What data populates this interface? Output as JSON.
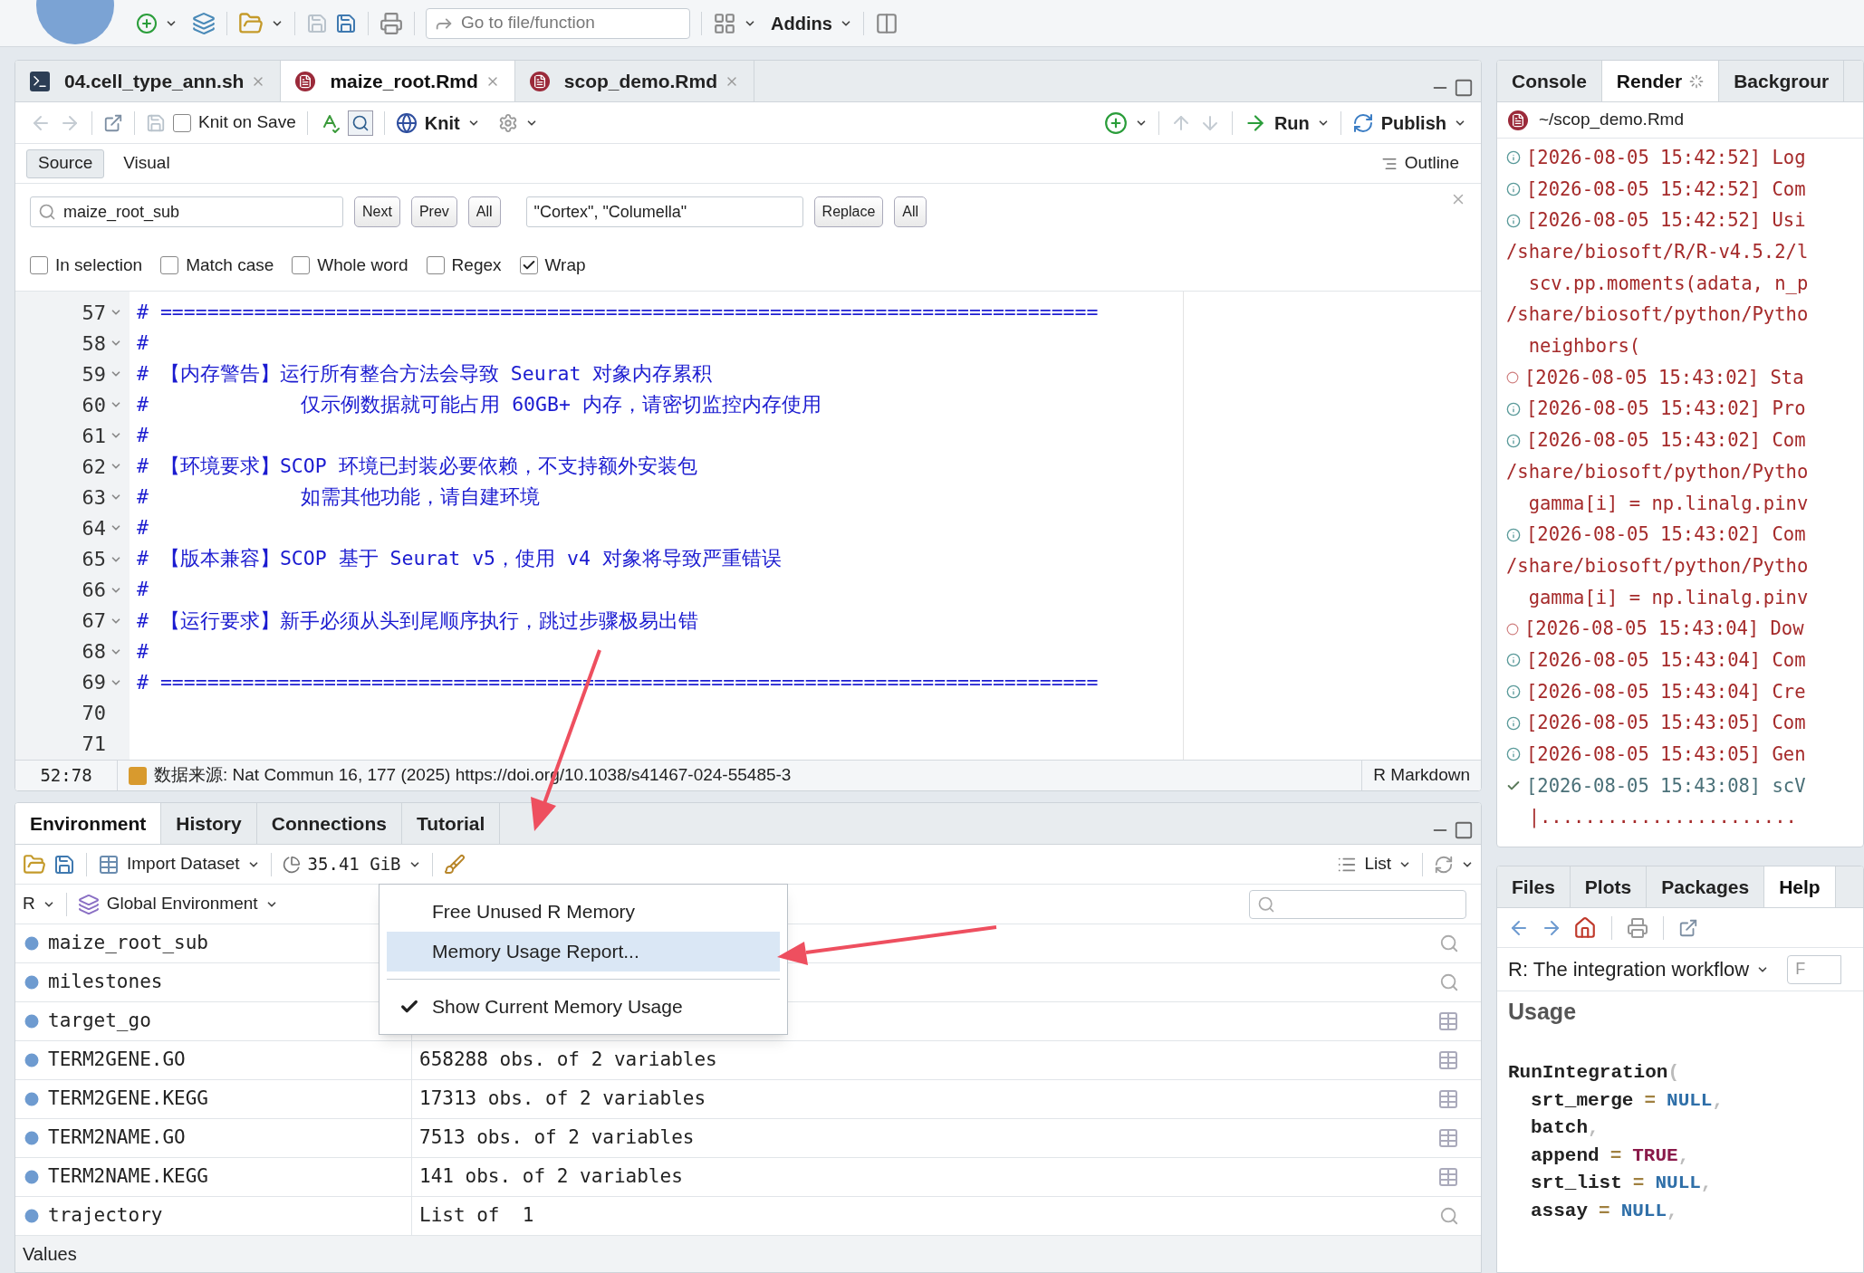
{
  "toolbar": {
    "goto_placeholder": "Go to file/function",
    "addins": "Addins"
  },
  "editor": {
    "tabs": [
      {
        "label": "04.cell_type_ann.sh",
        "kind": "shell",
        "selected": false
      },
      {
        "label": "maize_root.Rmd",
        "kind": "rmd",
        "selected": true
      },
      {
        "label": "scop_demo.Rmd",
        "kind": "rmd",
        "selected": false
      }
    ],
    "knit_on_save": {
      "label": "Knit on Save",
      "checked": false
    },
    "knit": "Knit",
    "run": "Run",
    "publish": "Publish",
    "modes": [
      {
        "label": "Source",
        "selected": true
      },
      {
        "label": "Visual",
        "selected": false
      }
    ],
    "outline": "Outline",
    "find": {
      "value": "maize_root_sub",
      "buttons": [
        "Next",
        "Prev",
        "All"
      ],
      "replace_value": "\"Cortex\", \"Columella\"",
      "replace_buttons": [
        "Replace",
        "All"
      ]
    },
    "options": [
      {
        "label": "In selection",
        "checked": false
      },
      {
        "label": "Match case",
        "checked": false
      },
      {
        "label": "Whole word",
        "checked": false
      },
      {
        "label": "Regex",
        "checked": false
      },
      {
        "label": "Wrap",
        "checked": true
      }
    ],
    "lines": [
      {
        "number": "57",
        "fold": true,
        "text": "# ================================================================================"
      },
      {
        "number": "58",
        "fold": true,
        "text": "#"
      },
      {
        "number": "59",
        "fold": true,
        "text": "# 【内存警告】运行所有整合方法会导致 Seurat 对象内存累积"
      },
      {
        "number": "60",
        "fold": true,
        "text": "#             仅示例数据就可能占用 60GB+ 内存，请密切监控内存使用"
      },
      {
        "number": "61",
        "fold": true,
        "text": "#"
      },
      {
        "number": "62",
        "fold": true,
        "text": "# 【环境要求】SCOP 环境已封装必要依赖，不支持额外安装包"
      },
      {
        "number": "63",
        "fold": true,
        "text": "#             如需其他功能，请自建环境"
      },
      {
        "number": "64",
        "fold": true,
        "text": "#"
      },
      {
        "number": "65",
        "fold": true,
        "text": "# 【版本兼容】SCOP 基于 Seurat v5，使用 v4 对象将导致严重错误"
      },
      {
        "number": "66",
        "fold": true,
        "text": "#"
      },
      {
        "number": "67",
        "fold": true,
        "text": "# 【运行要求】新手必须从头到尾顺序执行，跳过步骤极易出错"
      },
      {
        "number": "68",
        "fold": true,
        "text": "#"
      },
      {
        "number": "69",
        "fold": true,
        "text": "# ================================================================================"
      },
      {
        "number": "70",
        "fold": false
      },
      {
        "number": "71",
        "fold": false
      }
    ],
    "status": {
      "position": "52:78",
      "chunk": "数据来源: Nat Commun 16, 177 (2025) https://doi.org/10.1038/s41467-024-55485-3",
      "language": "R Markdown"
    }
  },
  "environment": {
    "tabs": [
      {
        "label": "Environment",
        "selected": true
      },
      {
        "label": "History",
        "selected": false
      },
      {
        "label": "Connections",
        "selected": false
      },
      {
        "label": "Tutorial",
        "selected": false
      }
    ],
    "import": "Import Dataset",
    "memory": "35.41 GiB",
    "view": "List",
    "language": "R",
    "scope": "Global Environment",
    "rows": [
      {
        "name": "maize_root_sub",
        "kind": "view"
      },
      {
        "name": "milestones",
        "kind": "view"
      },
      {
        "name": "target_go",
        "kind": "table"
      },
      {
        "name": "TERM2GENE.GO",
        "value": "658288 obs. of 2 variables",
        "kind": "table"
      },
      {
        "name": "TERM2GENE.KEGG",
        "value": "17313 obs. of 2 variables",
        "kind": "table"
      },
      {
        "name": "TERM2NAME.GO",
        "value": "7513 obs. of 2 variables",
        "kind": "table"
      },
      {
        "name": "TERM2NAME.KEGG",
        "value": "141 obs. of 2 variables",
        "kind": "table"
      },
      {
        "name": "trajectory",
        "value": "List of  1",
        "kind": "view"
      }
    ],
    "section": "Values"
  },
  "memory_menu": {
    "items": [
      {
        "label": "Free Unused R Memory",
        "kind": "command",
        "selected": false,
        "checked": false
      },
      {
        "label": "Memory Usage Report...",
        "kind": "command",
        "selected": true,
        "checked": false
      },
      {
        "label": "Show Current Memory Usage",
        "kind": "toggle",
        "selected": false,
        "checked": true
      }
    ]
  },
  "console": {
    "tabs": [
      {
        "label": "Console",
        "selected": false,
        "busy": false
      },
      {
        "label": "Render",
        "selected": true,
        "busy": true
      },
      {
        "label": "Backgrour",
        "selected": false,
        "busy": false
      }
    ],
    "path": "~/scop_demo.Rmd",
    "lines": [
      {
        "kind": "info",
        "text": "[2026-08-05 15:42:52] Log"
      },
      {
        "kind": "info",
        "text": "[2026-08-05 15:42:52] Com"
      },
      {
        "kind": "info",
        "text": "[2026-08-05 15:42:52] Usi"
      },
      {
        "kind": "plain",
        "text": "/share/biosoft/R/R-v4.5.2/l"
      },
      {
        "kind": "plain",
        "text": "  scv.pp.moments(adata, n_p"
      },
      {
        "kind": "plain",
        "text": "/share/biosoft/python/Pytho"
      },
      {
        "kind": "plain",
        "text": "  neighbors("
      },
      {
        "kind": "pending",
        "text": "[2026-08-05 15:43:02] Sta"
      },
      {
        "kind": "info",
        "text": "[2026-08-05 15:43:02] Pro"
      },
      {
        "kind": "info",
        "text": "[2026-08-05 15:43:02] Com"
      },
      {
        "kind": "plain",
        "text": "/share/biosoft/python/Pytho"
      },
      {
        "kind": "plain",
        "text": "  gamma[i] = np.linalg.pinv"
      },
      {
        "kind": "info",
        "text": "[2026-08-05 15:43:02] Com"
      },
      {
        "kind": "plain",
        "text": "/share/biosoft/python/Pytho"
      },
      {
        "kind": "plain",
        "text": "  gamma[i] = np.linalg.pinv"
      },
      {
        "kind": "pending",
        "text": "[2026-08-05 15:43:04] Dow"
      },
      {
        "kind": "info",
        "text": "[2026-08-05 15:43:04] Com"
      },
      {
        "kind": "info",
        "text": "[2026-08-05 15:43:04] Cre"
      },
      {
        "kind": "info",
        "text": "[2026-08-05 15:43:05] Com"
      },
      {
        "kind": "info",
        "text": "[2026-08-05 15:43:05] Gen"
      },
      {
        "kind": "success",
        "text": "[2026-08-05 15:43:08] scV"
      },
      {
        "kind": "plain",
        "text": "  |......................."
      }
    ]
  },
  "help": {
    "tabs": [
      {
        "label": "Files",
        "selected": false
      },
      {
        "label": "Plots",
        "selected": false
      },
      {
        "label": "Packages",
        "selected": false
      },
      {
        "label": "Help",
        "selected": true
      }
    ],
    "topic": "R: The integration workflow",
    "find_placeholder": "F",
    "heading": "Usage",
    "code": [
      [
        {
          "text": "RunIntegration",
          "kind": "name"
        },
        {
          "text": "(",
          "kind": "punct"
        }
      ],
      [
        {
          "text": "srt_merge",
          "kind": "name"
        },
        {
          "text": "=",
          "kind": "op"
        },
        {
          "text": "NULL",
          "kind": "null"
        },
        {
          "text": ",",
          "kind": "punct"
        }
      ],
      [
        {
          "text": "batch",
          "kind": "name"
        },
        {
          "text": ",",
          "kind": "punct"
        }
      ],
      [
        {
          "text": "append",
          "kind": "name"
        },
        {
          "text": "=",
          "kind": "op"
        },
        {
          "text": "TRUE",
          "kind": "logical"
        },
        {
          "text": ",",
          "kind": "punct"
        }
      ],
      [
        {
          "text": "srt_list",
          "kind": "name"
        },
        {
          "text": "=",
          "kind": "op"
        },
        {
          "text": "NULL",
          "kind": "null"
        },
        {
          "text": ",",
          "kind": "punct"
        }
      ],
      [
        {
          "text": "assay",
          "kind": "name"
        },
        {
          "text": "=",
          "kind": "op"
        },
        {
          "text": "NULL",
          "kind": "null"
        },
        {
          "text": ",",
          "kind": "punct"
        }
      ]
    ]
  }
}
